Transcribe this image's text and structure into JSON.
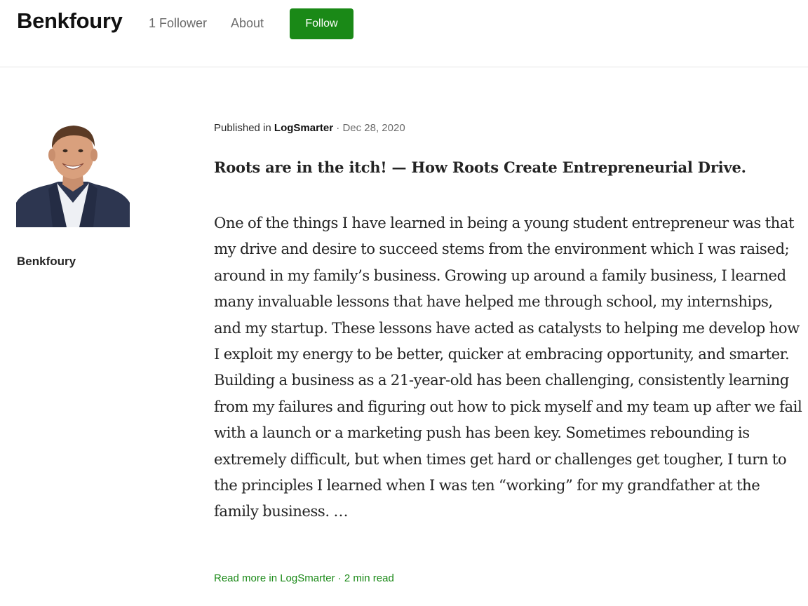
{
  "header": {
    "site_title": "Benkfoury",
    "followers": "1 Follower",
    "about": "About",
    "follow_label": "Follow"
  },
  "sidebar": {
    "author_name": "Benkfoury"
  },
  "post": {
    "published_prefix": "Published in",
    "publication": "LogSmarter",
    "separator": "·",
    "date": "Dec 28, 2020",
    "title": "Roots are in the itch! — How Roots Create Entrepreneurial Drive.",
    "body": "One of the things I have learned in being a young student entrepreneur was that my drive and desire to succeed stems from the environment which I was raised; around in my family’s business. Growing up around a family business, I learned many invaluable lessons that have helped me through school, my internships, and my startup. These lessons have acted as catalysts to helping me develop how I exploit my energy to be better, quicker at embracing opportunity, and smarter. Building a business as a 21-year-old has been challenging, consistently learning from my failures and figuring out how to pick myself and my team up after we fail with a launch or a marketing push has been key. Sometimes rebounding is extremely difficult, but when times get hard or challenges get tougher, I turn to the principles I learned when I was ten “working” for my grandfather at the family business. …",
    "read_more": "Read more in LogSmarter · 2 min read"
  },
  "colors": {
    "accent": "#1a8917",
    "text": "#242424",
    "muted": "#6b6b6b"
  }
}
